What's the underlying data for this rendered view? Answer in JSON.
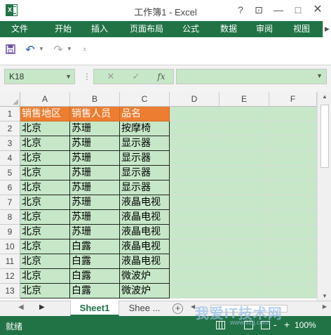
{
  "window": {
    "title": "工作簿1 - Excel",
    "help": "?",
    "restore_ribbon": "⊡",
    "minimize": "—",
    "maximize": "□"
  },
  "ribbon": {
    "tabs": [
      "文件",
      "开始",
      "插入",
      "页面布局",
      "公式",
      "数据",
      "审阅",
      "视图"
    ]
  },
  "formula_bar": {
    "name_box": "K18",
    "cancel": "✕",
    "enter": "✓",
    "fx": "fx",
    "formula": ""
  },
  "grid": {
    "columns": [
      "A",
      "B",
      "C",
      "D",
      "E",
      "F"
    ],
    "rows": [
      [
        "销售地区",
        "销售人员",
        "品名"
      ],
      [
        "北京",
        "苏珊",
        "按摩椅"
      ],
      [
        "北京",
        "苏珊",
        "显示器"
      ],
      [
        "北京",
        "苏珊",
        "显示器"
      ],
      [
        "北京",
        "苏珊",
        "显示器"
      ],
      [
        "北京",
        "苏珊",
        "显示器"
      ],
      [
        "北京",
        "苏珊",
        "液晶电视"
      ],
      [
        "北京",
        "苏珊",
        "液晶电视"
      ],
      [
        "北京",
        "苏珊",
        "液晶电视"
      ],
      [
        "北京",
        "白露",
        "液晶电视"
      ],
      [
        "北京",
        "白露",
        "液晶电视"
      ],
      [
        "北京",
        "白露",
        "微波炉"
      ],
      [
        "北京",
        "白露",
        "微波炉"
      ]
    ],
    "row_numbers": [
      "1",
      "2",
      "3",
      "4",
      "5",
      "6",
      "7",
      "8",
      "9",
      "10",
      "11",
      "12",
      "13"
    ]
  },
  "sheets": {
    "active": "Sheet1",
    "other": "Shee ...",
    "add": "+"
  },
  "status": {
    "text": "就绪",
    "zoom_minus": "-",
    "zoom_plus": "+",
    "zoom": "100%"
  },
  "watermark": {
    "text": "我爱IT技术网",
    "url": "www.52ij.com"
  },
  "colors": {
    "excel_green": "#217346",
    "header_orange": "#ed7d31",
    "cell_green": "#c6e8c8"
  }
}
